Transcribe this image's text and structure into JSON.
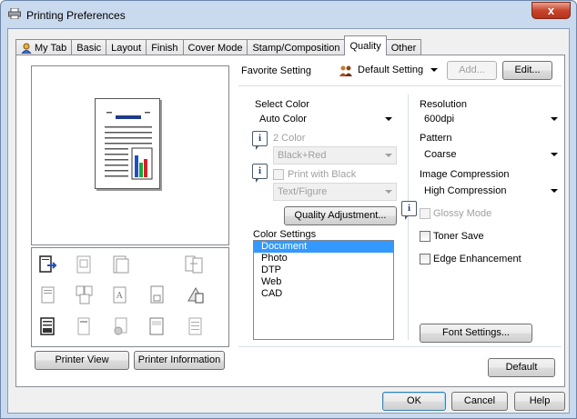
{
  "window": {
    "title": "Printing Preferences",
    "close_glyph": "x"
  },
  "tabs": [
    "My Tab",
    "Basic",
    "Layout",
    "Finish",
    "Cover Mode",
    "Stamp/Composition",
    "Quality",
    "Other"
  ],
  "active_tab": "Quality",
  "favorite": {
    "label": "Favorite Setting",
    "value": "Default Setting",
    "add_label": "Add...",
    "edit_label": "Edit..."
  },
  "select_color": {
    "label": "Select Color",
    "value": "Auto Color"
  },
  "two_color": {
    "label": "2 Color",
    "value": "Black+Red"
  },
  "print_with_black": {
    "label": "Print with Black",
    "value": "Text/Figure"
  },
  "quality_adjustment": "Quality Adjustment...",
  "color_settings": {
    "label": "Color Settings",
    "items": [
      "Document",
      "Photo",
      "DTP",
      "Web",
      "CAD"
    ],
    "selected": "Document"
  },
  "resolution": {
    "label": "Resolution",
    "value": "600dpi"
  },
  "pattern": {
    "label": "Pattern",
    "value": "Coarse"
  },
  "image_compression": {
    "label": "Image Compression",
    "value": "High Compression"
  },
  "glossy_mode": "Glossy Mode",
  "toner_save": "Toner Save",
  "edge_enhancement": "Edge Enhancement",
  "font_settings": "Font Settings...",
  "default_label": "Default",
  "printer_view": "Printer View",
  "printer_information": "Printer Information",
  "dialog": {
    "ok": "OK",
    "cancel": "Cancel",
    "help": "Help"
  },
  "info_glyph": "i",
  "colors": {
    "selection": "#3399ff",
    "chart_blue": "#1f4fc6",
    "chart_green": "#19a83b",
    "chart_red": "#d2222a",
    "title_blue": "#1f3c8c"
  }
}
